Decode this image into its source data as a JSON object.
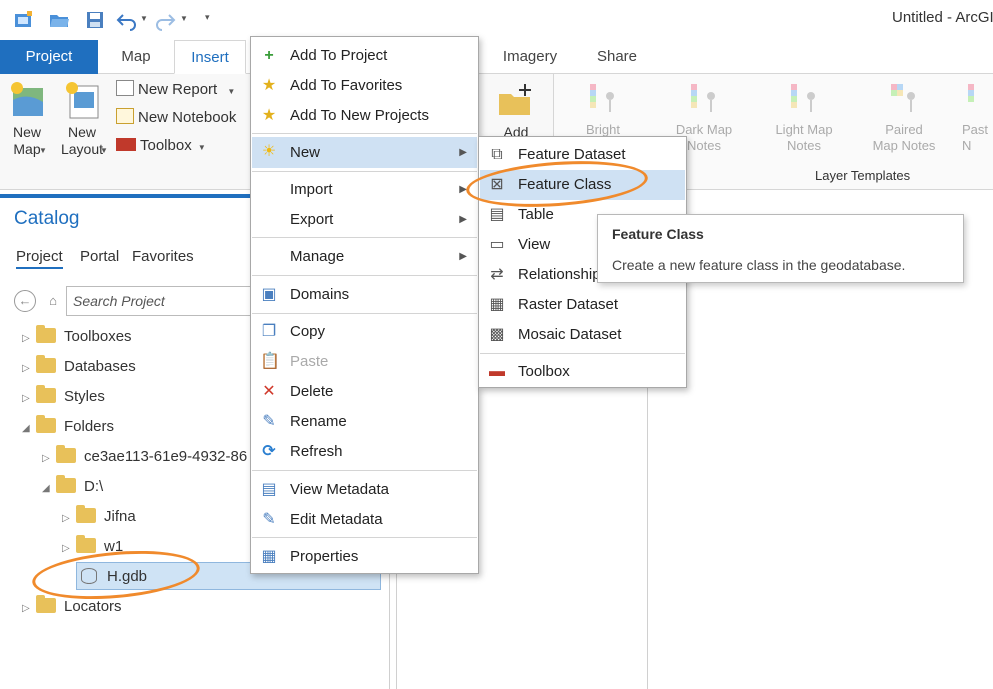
{
  "app": {
    "title": "Untitled - ArcGI"
  },
  "qat": {
    "icons": [
      "new-project-icon",
      "open-project-icon",
      "save-project-icon",
      "undo-icon",
      "redo-icon",
      "customize-qat-icon"
    ]
  },
  "tabs": [
    "Project",
    "Map",
    "Insert",
    "Imagery",
    "Share"
  ],
  "ribbon": {
    "new_map": "New\nMap",
    "new_layout": "New\nLayout",
    "new_report": "New Report",
    "new_notebook": "New Notebook",
    "toolbox": "Toolbox",
    "add_label": "Add",
    "templates": [
      "Bright",
      "Dark Map\nNotes",
      "Light Map\nNotes",
      "Paired\nMap Notes",
      "Past\nN"
    ],
    "layer_templates": "Layer Templates"
  },
  "catalog": {
    "title": "Catalog",
    "tabs": [
      "Project",
      "Portal",
      "Favorites"
    ],
    "search_placeholder": "Search Project",
    "tree": [
      {
        "label": "Toolboxes"
      },
      {
        "label": "Databases"
      },
      {
        "label": "Styles"
      },
      {
        "label": "Folders"
      },
      {
        "label": "ce3ae113-61e9-4932-86"
      },
      {
        "label": "D:\\"
      },
      {
        "label": "Jifna"
      },
      {
        "label": "w1"
      },
      {
        "label": "H.gdb"
      },
      {
        "label": "Locators"
      }
    ]
  },
  "context_menu": {
    "items": [
      {
        "label": "Add To Project",
        "icon": "plus-icon"
      },
      {
        "label": "Add To Favorites",
        "icon": "star-icon"
      },
      {
        "label": "Add To New Projects",
        "icon": "star-icon"
      },
      {
        "label": "New",
        "icon": "sun-icon"
      },
      {
        "label": "Import"
      },
      {
        "label": "Export"
      },
      {
        "label": "Manage"
      },
      {
        "label": "Domains",
        "icon": "domains-icon"
      },
      {
        "label": "Copy",
        "icon": "copy-icon"
      },
      {
        "label": "Paste",
        "icon": "paste-icon"
      },
      {
        "label": "Delete",
        "icon": "delete-icon"
      },
      {
        "label": "Rename",
        "icon": "pencil-icon"
      },
      {
        "label": "Refresh",
        "icon": "refresh-icon"
      },
      {
        "label": "View Metadata",
        "icon": "metadata-icon"
      },
      {
        "label": "Edit Metadata",
        "icon": "pencil-icon"
      },
      {
        "label": "Properties",
        "icon": "properties-icon"
      }
    ]
  },
  "new_submenu": {
    "items": [
      {
        "label": "Feature Dataset"
      },
      {
        "label": "Feature Class"
      },
      {
        "label": "Table"
      },
      {
        "label": "View"
      },
      {
        "label": "Relationship"
      },
      {
        "label": "Raster Dataset"
      },
      {
        "label": "Mosaic Dataset"
      },
      {
        "label": "Toolbox"
      }
    ]
  },
  "tooltip": {
    "title": "Feature Class",
    "description": "Create a new feature class in the geodatabase."
  },
  "colors": {
    "accent": "#1f6fbf",
    "highlight": "#cfe1f3",
    "annotation": "#f08a2c",
    "folder": "#e8c15a"
  }
}
